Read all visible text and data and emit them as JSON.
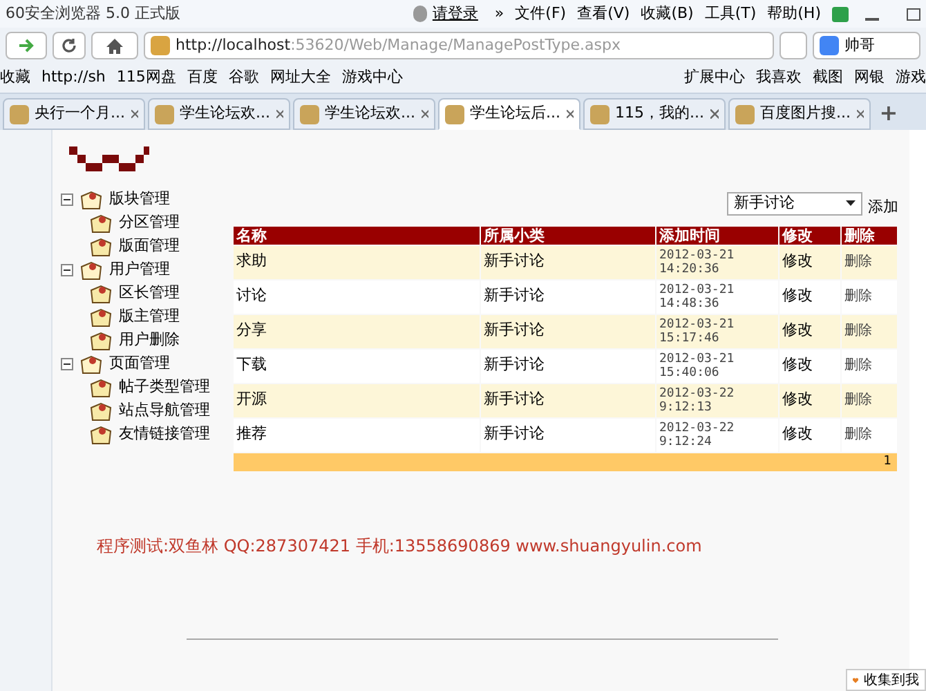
{
  "browser": {
    "title": "60安全浏览器 5.0 正式版",
    "login": "请登录",
    "more": "»",
    "menu": [
      "文件(F)",
      "查看(V)",
      "收藏(B)",
      "工具(T)",
      "帮助(H)"
    ],
    "url_host": "http://localhost",
    "url_rest": ":53620/Web/Manage/ManagePostType.aspx",
    "search_value": "帅哥",
    "bookmarks_left": [
      "收藏",
      "http://sh",
      "115网盘",
      "百度",
      "谷歌",
      "网址大全",
      "游戏中心"
    ],
    "bookmarks_right": [
      "扩展中心",
      "我喜欢",
      "截图",
      "网银",
      "游戏"
    ],
    "tabs": [
      {
        "label": "央行一个月...",
        "selected": false
      },
      {
        "label": "学生论坛欢...",
        "selected": false
      },
      {
        "label": "学生论坛欢...",
        "selected": false
      },
      {
        "label": "学生论坛后...",
        "selected": true
      },
      {
        "label": "115，我的...",
        "selected": false
      },
      {
        "label": "百度图片搜...",
        "selected": false
      }
    ],
    "new_tab": "+"
  },
  "page": {
    "tree": [
      {
        "label": "版块管理",
        "expanded": true,
        "children": [
          {
            "label": "分区管理"
          },
          {
            "label": "版面管理"
          }
        ]
      },
      {
        "label": "用户管理",
        "expanded": true,
        "children": [
          {
            "label": "区长管理"
          },
          {
            "label": "版主管理"
          },
          {
            "label": "用户删除"
          }
        ]
      },
      {
        "label": "页面管理",
        "expanded": true,
        "children": [
          {
            "label": "帖子类型管理"
          },
          {
            "label": "站点导航管理"
          },
          {
            "label": "友情链接管理"
          }
        ]
      }
    ],
    "filter": {
      "value": "新手讨论"
    },
    "add_link": "添加",
    "table": {
      "columns": [
        "名称",
        "所属小类",
        "添加时间",
        "修改",
        "删除"
      ],
      "rows": [
        [
          "求助",
          "新手讨论",
          "2012-03-21 14:20:36",
          "修改",
          "删除"
        ],
        [
          "讨论",
          "新手讨论",
          "2012-03-21 14:48:36",
          "修改",
          "删除"
        ],
        [
          "分享",
          "新手讨论",
          "2012-03-21 15:17:46",
          "修改",
          "删除"
        ],
        [
          "下载",
          "新手讨论",
          "2012-03-21 15:40:06",
          "修改",
          "删除"
        ],
        [
          "开源",
          "新手讨论",
          "2012-03-22 9:12:13",
          "修改",
          "删除"
        ],
        [
          "推荐",
          "新手讨论",
          "2012-03-22 9:12:24",
          "修改",
          "删除"
        ]
      ],
      "pager": "1"
    },
    "footer_text": "程序测试:双鱼林 QQ:287307421 手机:13558690869 www.shuangyulin.com",
    "collect_button": "收集到我"
  }
}
